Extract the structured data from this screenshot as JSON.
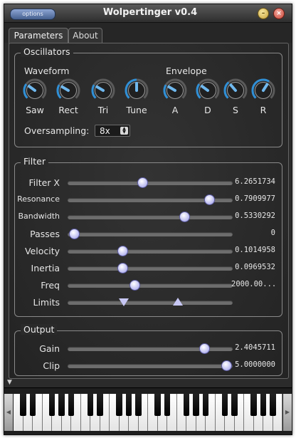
{
  "window": {
    "title": "Wolpertinger v0.4",
    "options_label": "options",
    "minimize_glyph": "–",
    "close_glyph": "×"
  },
  "tabs": [
    {
      "label": "Parameters",
      "active": true
    },
    {
      "label": "About",
      "active": false
    }
  ],
  "oscillators": {
    "title": "Oscillators",
    "waveform_title": "Waveform",
    "envelope_title": "Envelope",
    "waveform_knobs": [
      {
        "label": "Saw",
        "level": 0.3
      },
      {
        "label": "Rect",
        "level": 0.28
      },
      {
        "label": "Tri",
        "level": 0.28
      },
      {
        "label": "Tune",
        "level": 0.5
      }
    ],
    "envelope_knobs": [
      {
        "label": "A",
        "level": 0.28
      },
      {
        "label": "D",
        "level": 0.3
      },
      {
        "label": "S",
        "level": 0.35
      },
      {
        "label": "R",
        "level": 0.62
      }
    ],
    "oversampling_label": "Oversampling:",
    "oversampling_value": "8x"
  },
  "filter": {
    "title": "Filter",
    "sliders": [
      {
        "label": "Filter X",
        "value_text": "6.2651734",
        "fraction": 0.45
      },
      {
        "label": "Resonance",
        "value_text": "0.7909977",
        "fraction": 0.88
      },
      {
        "label": "Bandwidth",
        "value_text": "0.5330292",
        "fraction": 0.72
      },
      {
        "label": "Passes",
        "value_text": "0",
        "fraction": 0.01
      },
      {
        "label": "Velocity",
        "value_text": "0.1014958",
        "fraction": 0.32
      },
      {
        "label": "Inertia",
        "value_text": "0.0969532",
        "fraction": 0.32
      },
      {
        "label": "Freq",
        "value_text": "2000.00...",
        "fraction": 0.4
      }
    ],
    "limits_label": "Limits",
    "limits_low_fraction": 0.34,
    "limits_high_fraction": 0.67
  },
  "output": {
    "title": "Output",
    "sliders": [
      {
        "label": "Gain",
        "value_text": "2.4045711",
        "fraction": 0.85
      },
      {
        "label": "Clip",
        "value_text": "5.0000000",
        "fraction": 0.99
      }
    ]
  },
  "keyboard": {
    "scroll_left": "◀",
    "scroll_right": "▶",
    "expander_glyph": "▼"
  },
  "colors": {
    "knob_arc": "#2f8fd6",
    "handle": "#c7c7f4"
  }
}
